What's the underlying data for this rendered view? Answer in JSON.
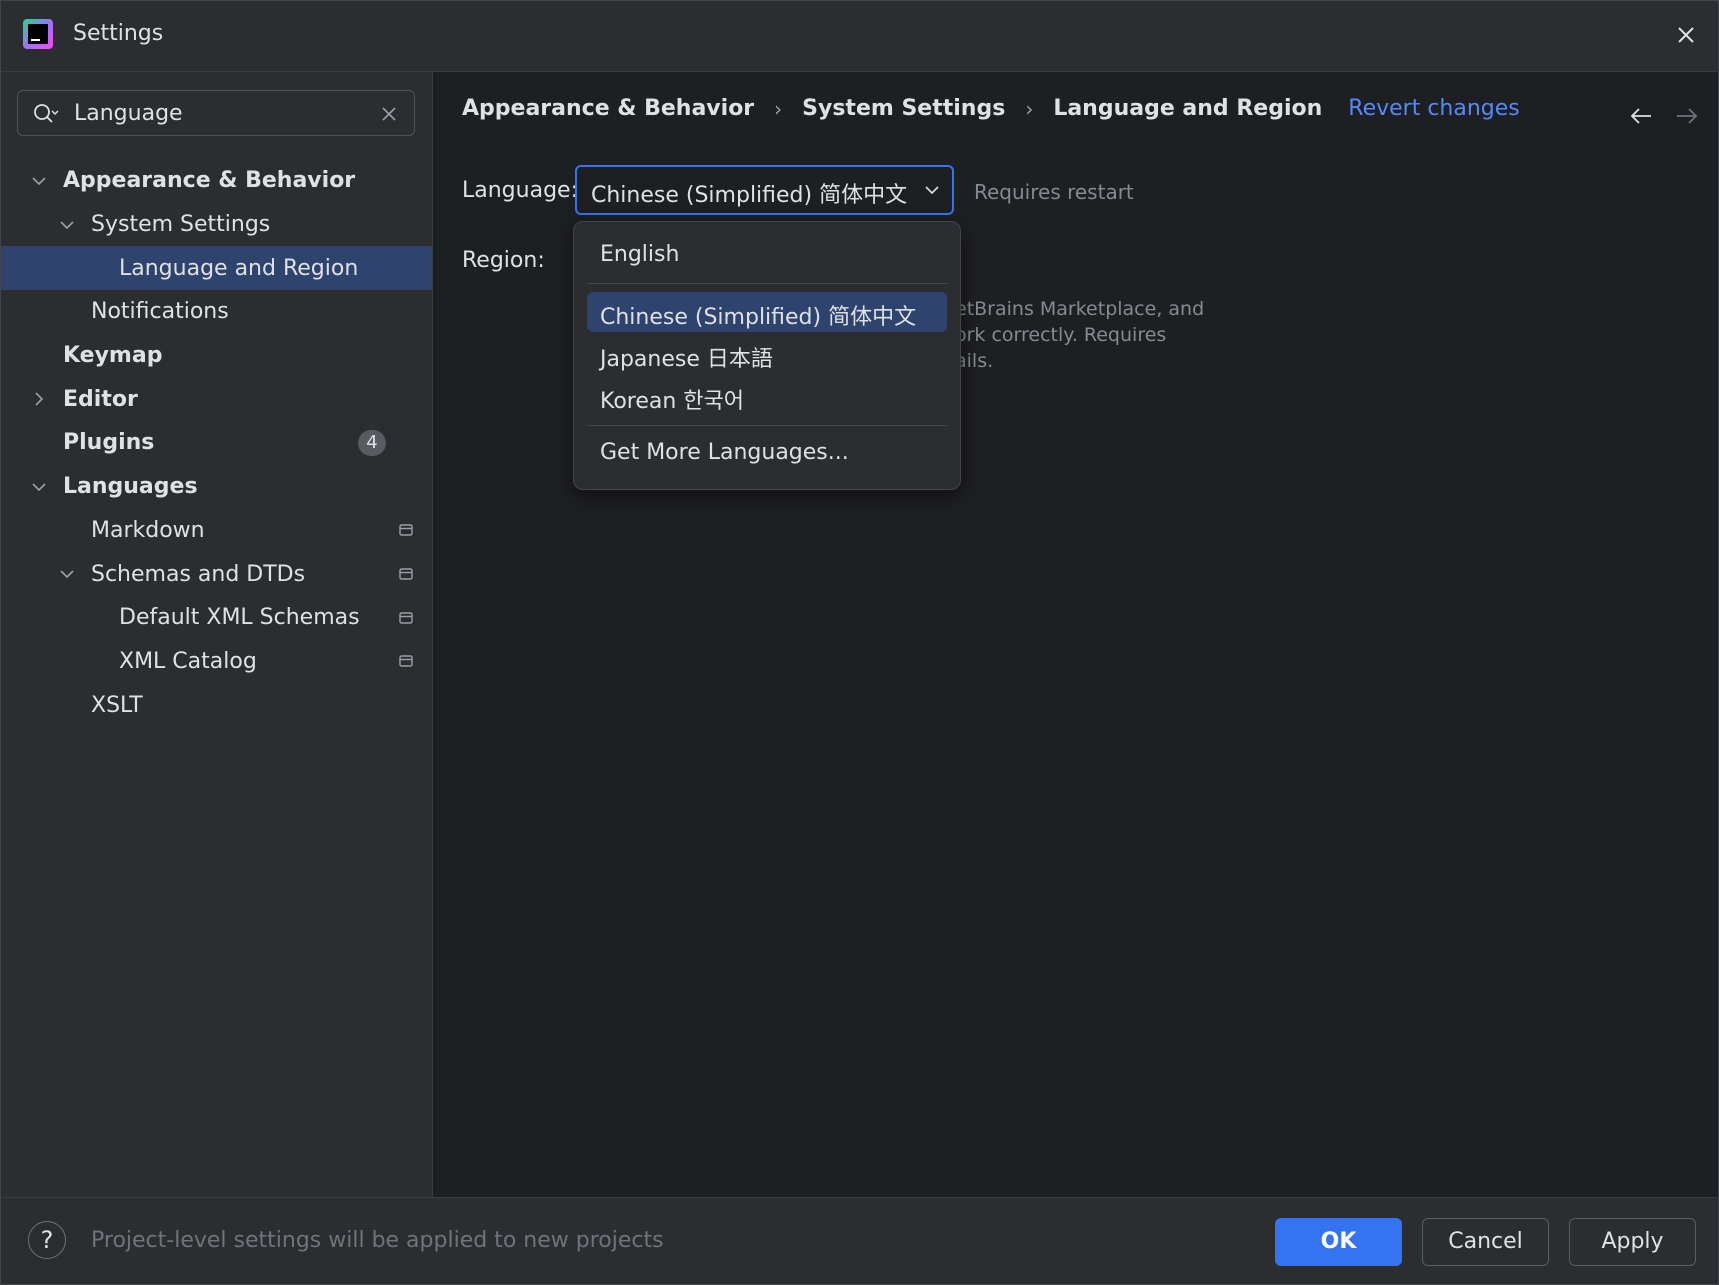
{
  "window": {
    "title": "Settings",
    "app_icon_text": "DG"
  },
  "search": {
    "value": "Language"
  },
  "tree": [
    {
      "label": "Appearance & Behavior",
      "level": 0,
      "bold": true,
      "chevron": "down"
    },
    {
      "label": "System Settings",
      "level": 1,
      "bold": false,
      "chevron": "down"
    },
    {
      "label": "Language and Region",
      "level": 2,
      "bold": false,
      "selected": true
    },
    {
      "label": "Notifications",
      "level": 1,
      "bold": false
    },
    {
      "label": "Keymap",
      "level": 0,
      "bold": true
    },
    {
      "label": "Editor",
      "level": 0,
      "bold": true,
      "chevron": "right"
    },
    {
      "label": "Plugins",
      "level": 0,
      "bold": true,
      "badge": "4"
    },
    {
      "label": "Languages",
      "level": 0,
      "bold": true,
      "chevron": "down"
    },
    {
      "label": "Markdown",
      "level": 1,
      "bold": false,
      "project_icon": true
    },
    {
      "label": "Schemas and DTDs",
      "level": 1,
      "bold": false,
      "chevron": "down",
      "project_icon": true
    },
    {
      "label": "Default XML Schemas",
      "level": 2,
      "bold": false,
      "project_icon": true
    },
    {
      "label": "XML Catalog",
      "level": 2,
      "bold": false,
      "project_icon": true
    },
    {
      "label": "XSLT",
      "level": 1,
      "bold": false
    }
  ],
  "breadcrumb": {
    "items": [
      "Appearance & Behavior",
      "System Settings",
      "Language and Region"
    ],
    "separator": "›",
    "revert": "Revert changes"
  },
  "language": {
    "label": "Language:",
    "selected": "Chinese (Simplified) 简体中文",
    "hint": "Requires restart"
  },
  "region": {
    "label": "Region:"
  },
  "description": {
    "lines": [
      "etBrains Marketplace, and",
      "ork correctly. Requires",
      "ails."
    ]
  },
  "dropdown": {
    "options": [
      "English",
      "Chinese (Simplified) 简体中文",
      "Japanese 日本語",
      "Korean 한국어"
    ],
    "more": "Get More Languages...",
    "selected_index": 1
  },
  "footer": {
    "help": "?",
    "note": "Project-level settings will be applied to new projects",
    "ok": "OK",
    "cancel": "Cancel",
    "apply": "Apply"
  },
  "colors": {
    "accent": "#3574f0",
    "selection": "#2e436e",
    "link": "#548af7",
    "panel": "#2b2d30",
    "background": "#1e1f22"
  }
}
